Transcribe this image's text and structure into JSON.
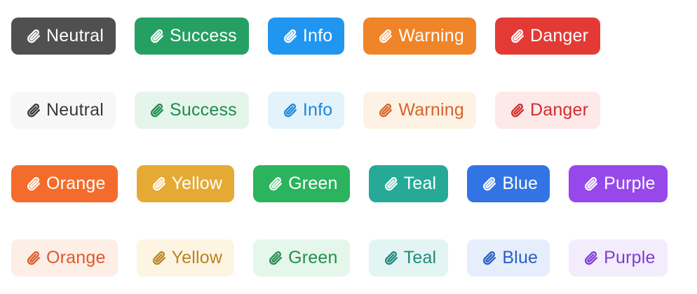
{
  "icon": "paperclip-icon",
  "rows": [
    {
      "style": "solid",
      "badges": [
        {
          "key": "neutral",
          "label": "Neutral",
          "bg": "#505050",
          "fg": "#ffffff"
        },
        {
          "key": "success",
          "label": "Success",
          "bg": "#25a062",
          "fg": "#ffffff"
        },
        {
          "key": "info",
          "label": "Info",
          "bg": "#2196f0",
          "fg": "#ffffff"
        },
        {
          "key": "warning",
          "label": "Warning",
          "bg": "#f08428",
          "fg": "#ffffff"
        },
        {
          "key": "danger",
          "label": "Danger",
          "bg": "#e33a36",
          "fg": "#ffffff"
        }
      ]
    },
    {
      "style": "soft",
      "badges": [
        {
          "key": "neutral",
          "label": "Neutral",
          "bg": "#f7f7f7",
          "fg": "#3a3a3a"
        },
        {
          "key": "success",
          "label": "Success",
          "bg": "#e5f5ec",
          "fg": "#1f8a4f"
        },
        {
          "key": "info",
          "label": "Info",
          "bg": "#e3f3fc",
          "fg": "#1e86d6"
        },
        {
          "key": "warning",
          "label": "Warning",
          "bg": "#fef2e4",
          "fg": "#d5642a"
        },
        {
          "key": "danger",
          "label": "Danger",
          "bg": "#fde9e8",
          "fg": "#cf2f2f"
        }
      ]
    },
    {
      "style": "solid",
      "badges": [
        {
          "key": "orange",
          "label": "Orange",
          "bg": "#f36c2c",
          "fg": "#ffffff"
        },
        {
          "key": "yellow",
          "label": "Yellow",
          "bg": "#e4aa33",
          "fg": "#ffffff"
        },
        {
          "key": "green",
          "label": "Green",
          "bg": "#2bb35d",
          "fg": "#ffffff"
        },
        {
          "key": "teal",
          "label": "Teal",
          "bg": "#26aa97",
          "fg": "#ffffff"
        },
        {
          "key": "blue",
          "label": "Blue",
          "bg": "#3274e3",
          "fg": "#ffffff"
        },
        {
          "key": "purple",
          "label": "Purple",
          "bg": "#9748ea",
          "fg": "#ffffff"
        }
      ]
    },
    {
      "style": "soft",
      "badges": [
        {
          "key": "orange",
          "label": "Orange",
          "bg": "#fdeee6",
          "fg": "#dc5a2b"
        },
        {
          "key": "yellow",
          "label": "Yellow",
          "bg": "#fdf4e2",
          "fg": "#b88424"
        },
        {
          "key": "green",
          "label": "Green",
          "bg": "#e5f6ea",
          "fg": "#238f4d"
        },
        {
          "key": "teal",
          "label": "Teal",
          "bg": "#e2f5f2",
          "fg": "#1e8a7c"
        },
        {
          "key": "blue",
          "label": "Blue",
          "bg": "#e6eefb",
          "fg": "#2a5ec4"
        },
        {
          "key": "purple",
          "label": "Purple",
          "bg": "#f3ecfd",
          "fg": "#7f3dd0"
        }
      ]
    }
  ]
}
